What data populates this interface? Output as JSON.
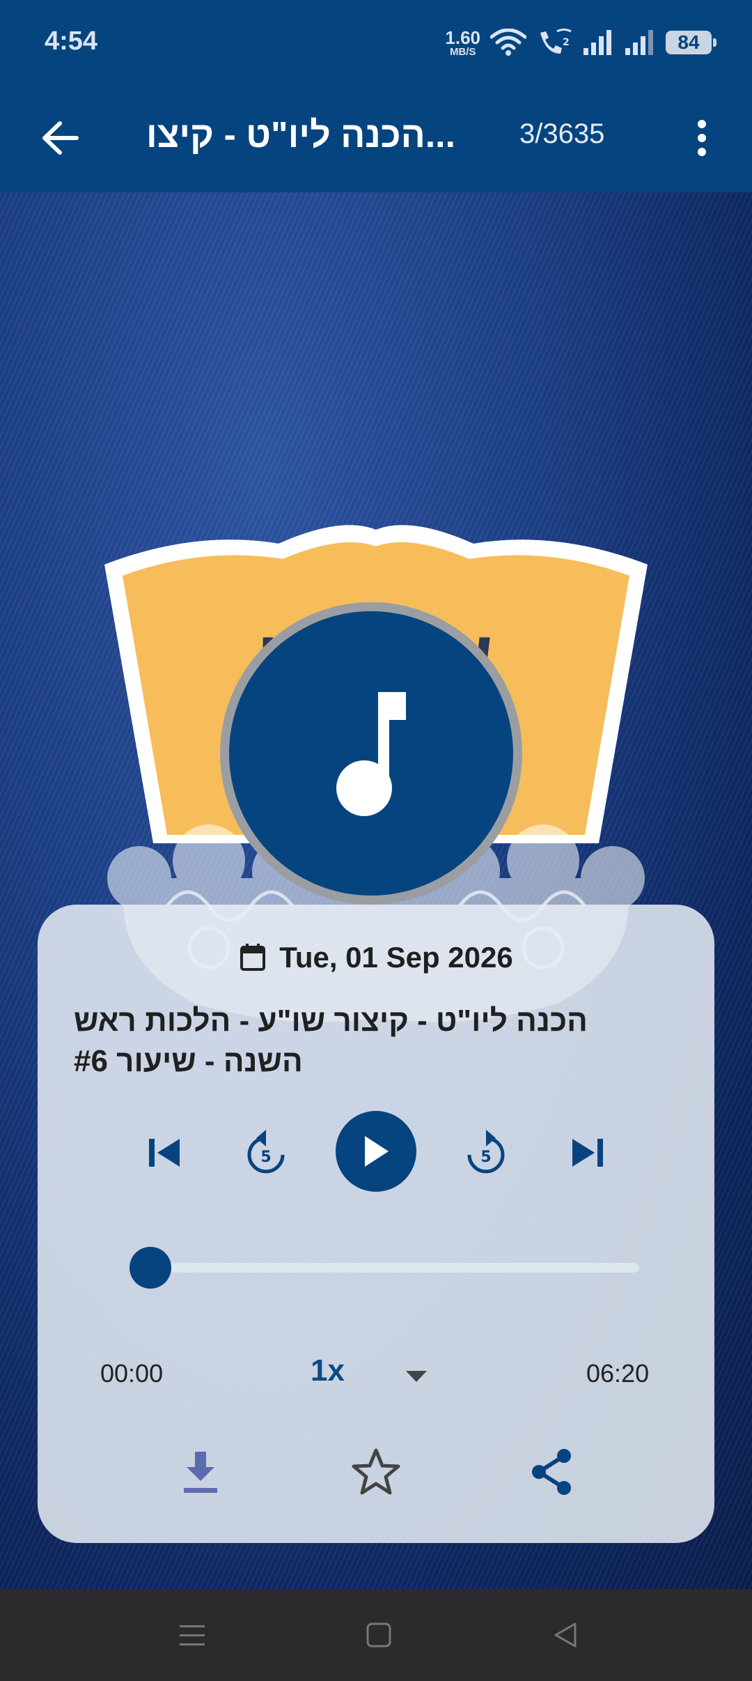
{
  "status_bar": {
    "time": "4:54",
    "net_speed_value": "1.60",
    "net_speed_unit": "MB/S",
    "battery": "84"
  },
  "app_bar": {
    "title": "הכנה ליו\"ט - קיצו...",
    "counter": "3/3635"
  },
  "artwork": {
    "title_text": "שיעורי",
    "icon": "music-note-icon"
  },
  "player": {
    "date": "Tue, 01 Sep 2026",
    "track_title": "הכנה ליו\"ט - קיצור שו\"ע - הלכות ראש השנה - שיעור #6",
    "progress_fraction": 0,
    "elapsed": "00:00",
    "speed": "1x",
    "total": "06:20",
    "skip_seconds": "5"
  },
  "colors": {
    "primary": "#06447f",
    "card": "#e8edf4",
    "download_icon": "#5c6bb0",
    "share_icon": "#06447f"
  }
}
